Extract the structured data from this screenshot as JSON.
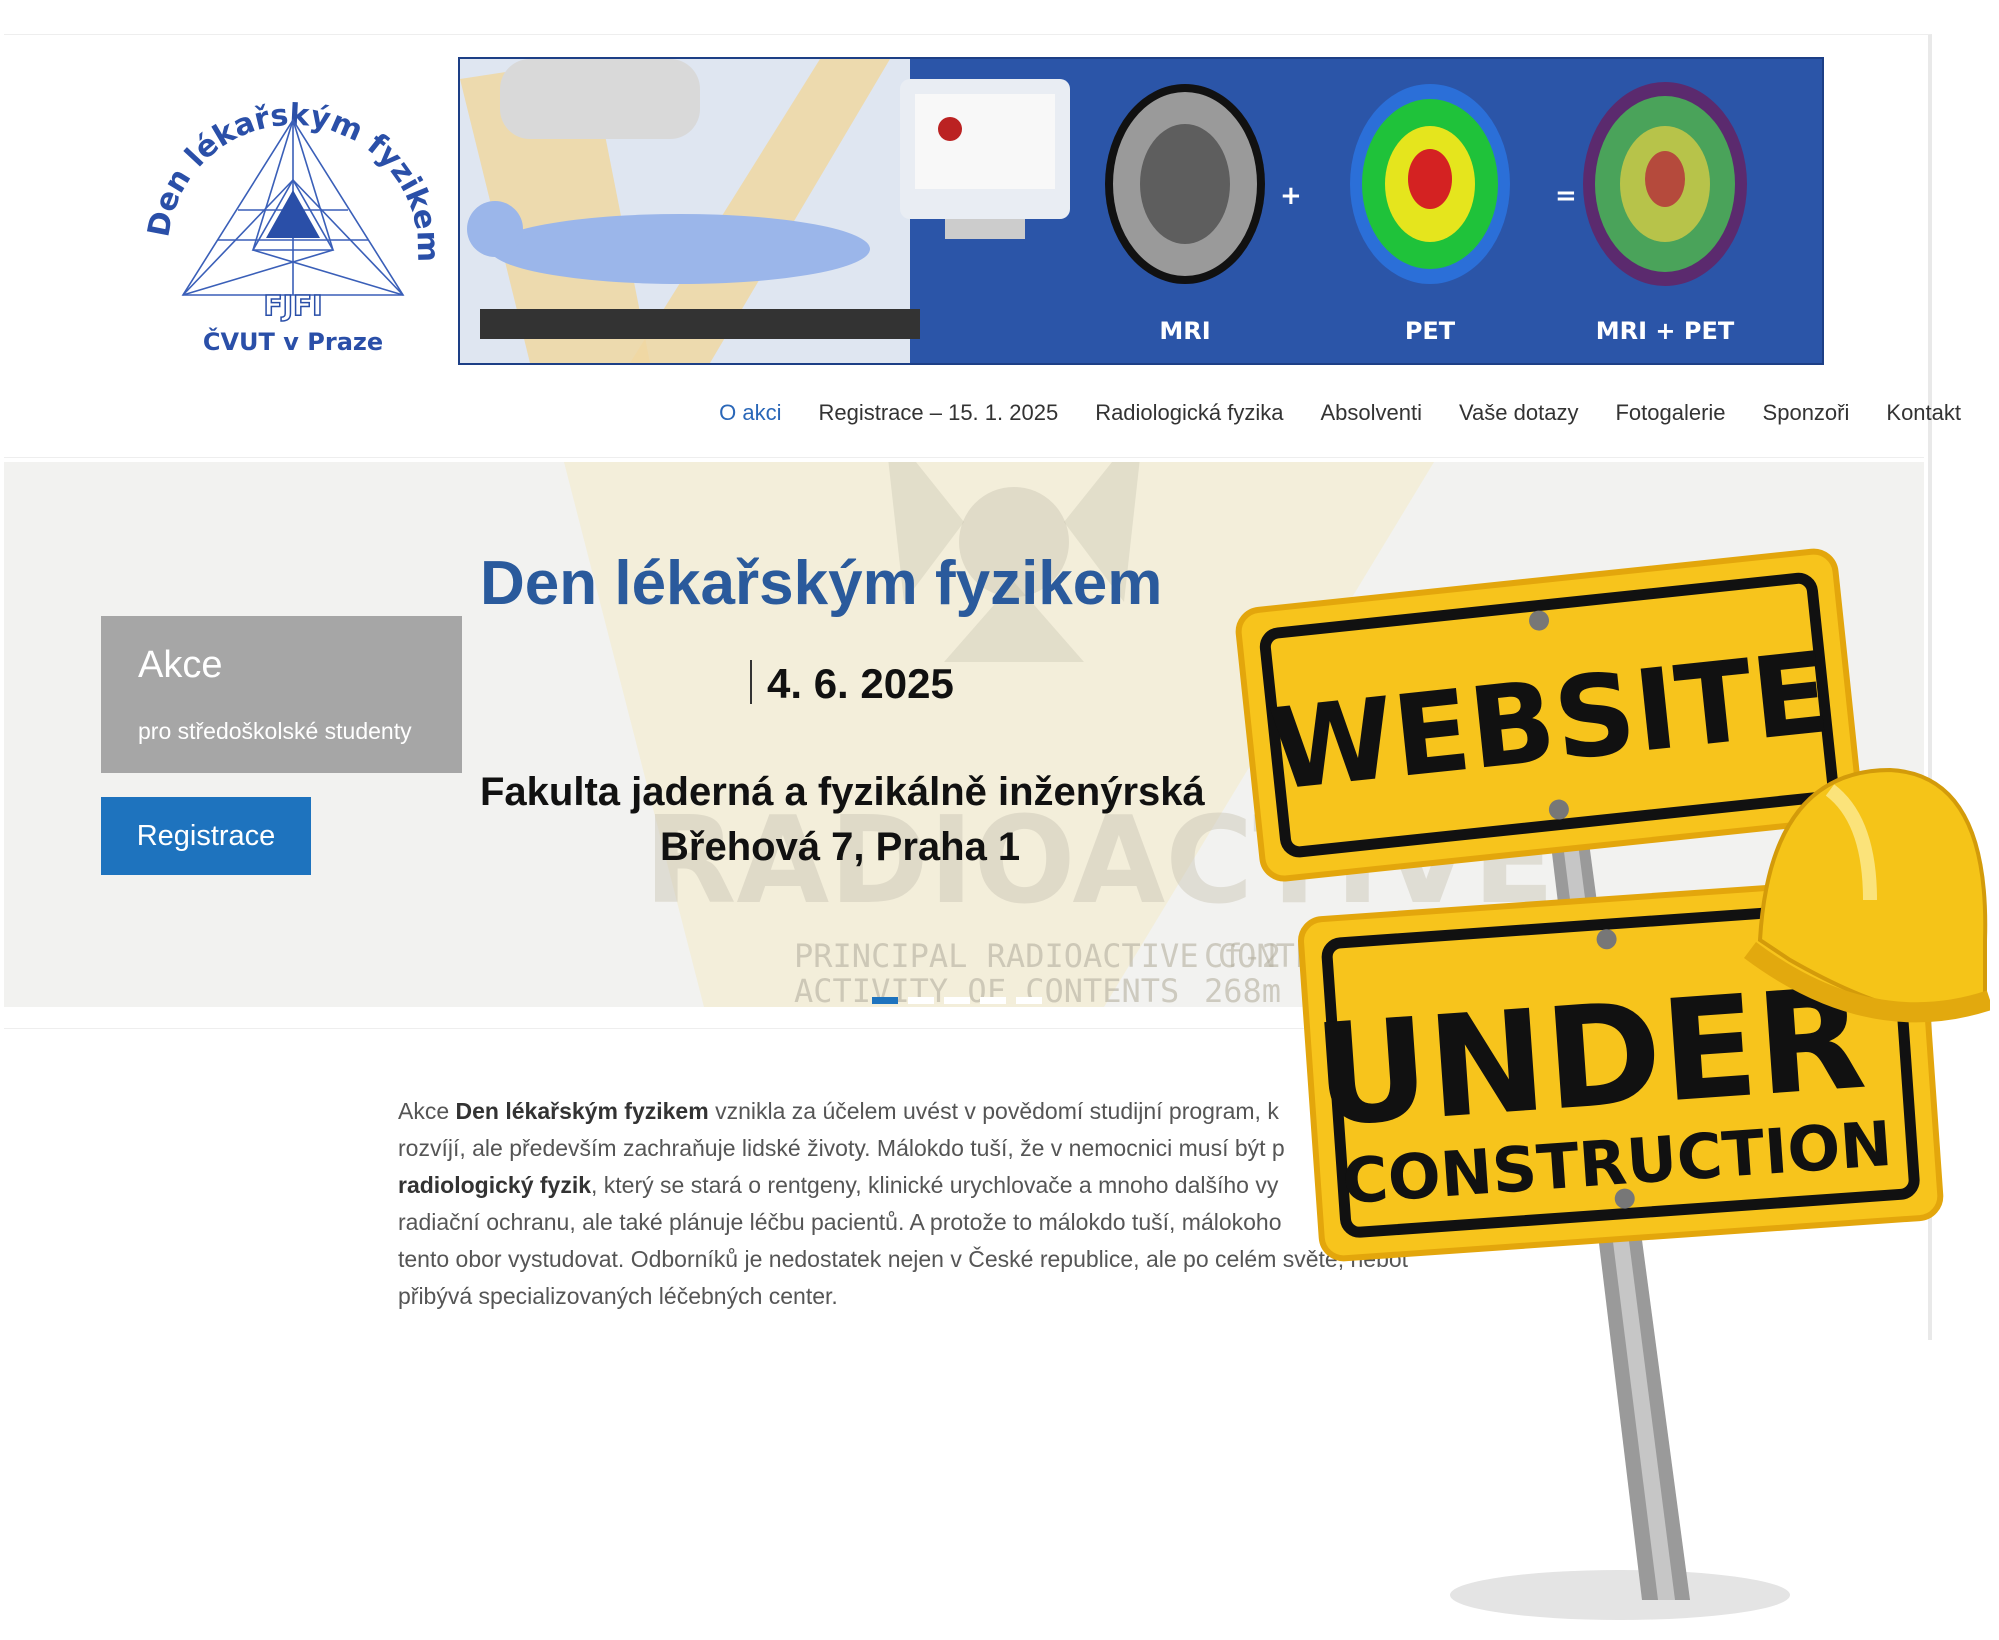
{
  "logo": {
    "arc_text": "Den lékařským fyzikem",
    "faculty": "FJFI",
    "university": "ČVUT v Praze"
  },
  "banner": {
    "label_mri": "MRI",
    "plus": "+",
    "label_pet": "PET",
    "equals": "=",
    "label_mri_pet": "MRI + PET"
  },
  "nav": {
    "items": [
      {
        "label": "O akci",
        "active": true
      },
      {
        "label": "Registrace – 15. 1. 2025"
      },
      {
        "label": "Radiologická fyzika"
      },
      {
        "label": "Absolventi"
      },
      {
        "label": "Vaše dotazy"
      },
      {
        "label": "Fotogalerie"
      },
      {
        "label": "Sponzoři"
      },
      {
        "label": "Kontakt"
      }
    ]
  },
  "hero": {
    "title": "Den lékařským fyzikem",
    "date": "4. 6. 2025",
    "faculty": "Fakulta jaderná a fyzikálně inženýrská",
    "address": "Břehová 7, Praha 1",
    "bg_text_1": "RADIOACTIVE",
    "bg_text_2": "PRINCIPAL RADIOACTIVE CONTENT",
    "bg_text_3": "ACTIVITY OF CONTENTS",
    "bg_text_4": "Cf-2",
    "bg_text_5": "268m",
    "akce_title": "Akce",
    "akce_subtitle": "pro středoškolské studenty",
    "register_button": "Registrace",
    "slides": 5,
    "active_slide": 1
  },
  "content": {
    "p1": "Akce ",
    "b1": "Den lékařským fyzikem",
    "p2": " vznikla za účelem uvést v povědomí studijní program, k",
    "p3": "rozvíjí, ale především zachraňuje lidské životy. Málokdo tuší, že v nemocnici musí být p",
    "b2": "radiologický fyzik",
    "p4": ", který se stará o rentgeny, klinické urychlovače a mnoho dalšího vy",
    "p5": "radiační ochranu, ale také plánuje léčbu pacientů. A protože to málokdo tuší, málokoho",
    "p6": "tento obor vystudovat. Odborníků je nedostatek nejen v České republice, ale po celém světě, neboť",
    "p7": "přibývá specializovaných léčebných center."
  },
  "sign": {
    "line1": "WEBSITE",
    "line2": "UNDER",
    "line3": "CONSTRUCTION"
  },
  "colors": {
    "accent": "#1e73be",
    "title_blue": "#2a5a9c",
    "sign_yellow": "#f7c41c",
    "banner_blue": "#2b55a8"
  }
}
